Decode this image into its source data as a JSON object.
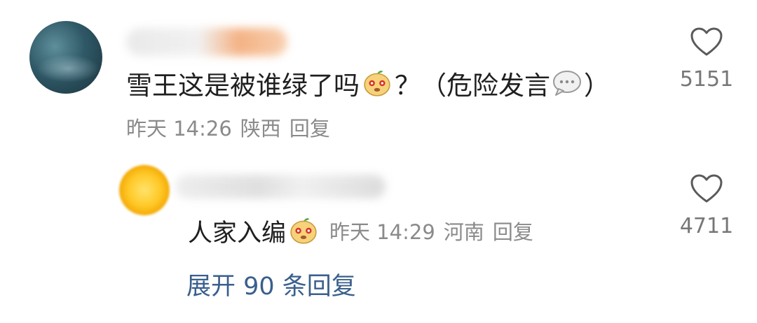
{
  "comment": {
    "text_before_emoji": "雪王这是被谁绿了吗",
    "text_after_emoji": "？（危险发言",
    "text_close": "）",
    "emoji_icon": "mascot-face-icon",
    "bubble_icon": "speech-bubble-icon",
    "time": "昨天 14:26",
    "location": "陕西",
    "reply_label": "回复",
    "like_count": "5151"
  },
  "reply": {
    "text": "人家入编",
    "emoji_icon": "mascot-face-icon",
    "time": "昨天 14:29",
    "location": "河南",
    "reply_label": "回复",
    "like_count": "4711"
  },
  "expand": {
    "label": "展开 90 条回复"
  },
  "colors": {
    "link": "#3a5f8c",
    "meta": "#8a8a8a",
    "text": "#1f1f1f"
  }
}
